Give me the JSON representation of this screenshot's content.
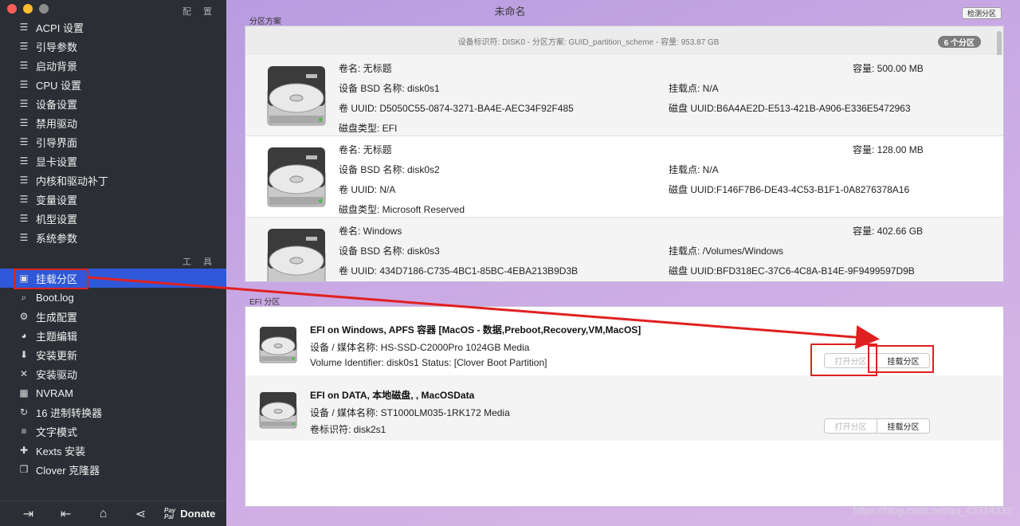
{
  "window": {
    "title": "未命名",
    "detect_button": "检测分区"
  },
  "sidebar": {
    "section_config": "配 置",
    "section_tools": "工 具",
    "config_items": [
      {
        "label": "ACPI 设置",
        "icon": "list-icon"
      },
      {
        "label": "引导参数",
        "icon": "list-icon"
      },
      {
        "label": "启动背景",
        "icon": "list-icon"
      },
      {
        "label": "CPU 设置",
        "icon": "list-icon"
      },
      {
        "label": "设备设置",
        "icon": "list-icon"
      },
      {
        "label": "禁用驱动",
        "icon": "list-icon"
      },
      {
        "label": "引导界面",
        "icon": "list-icon"
      },
      {
        "label": "显卡设置",
        "icon": "list-icon"
      },
      {
        "label": "内核和驱动补丁",
        "icon": "list-icon"
      },
      {
        "label": "变量设置",
        "icon": "list-icon"
      },
      {
        "label": "机型设置",
        "icon": "list-icon"
      },
      {
        "label": "系统参数",
        "icon": "list-icon"
      }
    ],
    "tool_items": [
      {
        "label": "挂载分区",
        "icon": "disk-icon",
        "active": true
      },
      {
        "label": "Boot.log",
        "icon": "log-search-icon"
      },
      {
        "label": "生成配置",
        "icon": "gears-icon"
      },
      {
        "label": "主题编辑",
        "icon": "palette-icon"
      },
      {
        "label": "安装更新",
        "icon": "download-icon"
      },
      {
        "label": "安装驱动",
        "icon": "tools-icon"
      },
      {
        "label": "NVRAM",
        "icon": "chip-icon"
      },
      {
        "label": "16 进制转换器",
        "icon": "refresh-icon"
      },
      {
        "label": "文字模式",
        "icon": "text-lines-icon"
      },
      {
        "label": "Kexts 安装",
        "icon": "puzzle-icon"
      },
      {
        "label": "Clover 克隆器",
        "icon": "copy-icon"
      }
    ],
    "bottom": {
      "donate_label": "Donate",
      "paypal_top": "Pay",
      "paypal_bottom": "Pal"
    }
  },
  "partitions": {
    "group_label": "分区方案",
    "header_text": "设备标识符: DISK0 - 分区方案: GUID_partition_scheme - 容量: 953.87 GB",
    "count_badge": "6 个分区",
    "rows": [
      {
        "volume": "卷名: 无标题",
        "bsd": "设备 BSD 名称: disk0s1",
        "uuid": "卷 UUID: D5050C55-0874-3271-BA4E-AEC34F92F485",
        "type": "磁盘类型: EFI",
        "capacity": "容量:  500.00 MB",
        "mount": "挂载点: N/A",
        "disk_uuid": "磁盘 UUID:B6A4AE2D-E513-421B-A906-E336E5472963"
      },
      {
        "volume": "卷名: 无标题",
        "bsd": "设备 BSD 名称: disk0s2",
        "uuid": "卷 UUID: N/A",
        "type": "磁盘类型: Microsoft Reserved",
        "capacity": "容量:  128.00 MB",
        "mount": "挂载点: N/A",
        "disk_uuid": "磁盘 UUID:F146F7B6-DE43-4C53-B1F1-0A8276378A16"
      },
      {
        "volume": "卷名: Windows",
        "bsd": "设备 BSD 名称: disk0s3",
        "uuid": "卷 UUID: 434D7186-C735-4BC1-85BC-4EBA213B9D3B",
        "type": "",
        "capacity": "容量:  402.66 GB",
        "mount": "挂载点: /Volumes/Windows",
        "disk_uuid": "磁盘 UUID:BFD318EC-37C6-4C8A-B14E-9F9499597D9B"
      }
    ]
  },
  "efi": {
    "group_label": "EFI 分区",
    "rows": [
      {
        "title": "EFI on Windows, APFS 容器 [MacOS - 数据,Preboot,Recovery,VM,MacOS]",
        "line1": "设备 / 媒体名称: HS-SSD-C2000Pro 1024GB Media",
        "line2": "Volume Identifier: disk0s1 Status: [Clover Boot Partition]",
        "open_label": "打开分区",
        "mount_label": "挂载分区"
      },
      {
        "title": "EFI on DATA, 本地磁盘, , MacOSData",
        "line1": "设备 / 媒体名称: ST1000LM035-1RK172 Media",
        "line2": "卷标识符: disk2s1",
        "open_label": "打开分区",
        "mount_label": "挂载分区"
      }
    ]
  },
  "watermark": "https://blog.csdn.net/qq_43714332",
  "colors": {
    "active": "#2f58d8",
    "annotation": "#e02020"
  }
}
